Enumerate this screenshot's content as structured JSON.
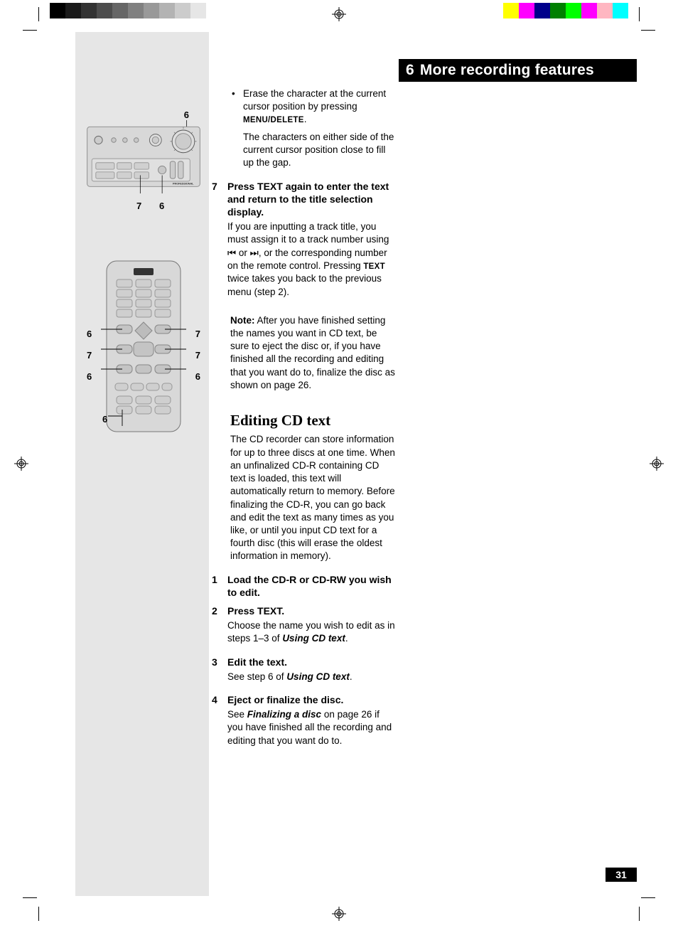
{
  "chapter": {
    "number": "6",
    "title": "More recording features"
  },
  "page_number": "31",
  "device_callouts": {
    "top": "6",
    "bottom_left": "7",
    "bottom_right": "6"
  },
  "remote_callouts": {
    "l1": "6",
    "r1": "7",
    "l2": "7",
    "r2": "7",
    "l3": "6",
    "r3": "6",
    "b1": "6"
  },
  "bullet1_a": "Erase the character at the current cursor position by pressing ",
  "bullet1_key": "MENU/DELETE",
  "bullet1_end": ".",
  "bullet1_sub": "The characters on either side of the current cursor position close to fill up the gap.",
  "step7": {
    "n": "7",
    "head": "Press TEXT again to enter the text and return to the title selection display."
  },
  "step7_body_a": "If you are inputting a track title, you must assign it to a track number using ",
  "step7_body_b": " or ",
  "step7_body_c": ", or the corresponding number on the remote control. Pressing ",
  "step7_body_key": "TEXT",
  "step7_body_d": " twice takes you back to the previous menu (step 2).",
  "note_label": "Note:",
  "note_body": " After you have finished setting the names you want in CD text, be sure to eject the disc or, if you have finished all the recording and editing that you want do to, finalize the disc as shown on page 26.",
  "heading_edit": "Editing CD text",
  "edit_intro": "The CD recorder can store information for up to three discs at one time. When an unfinalized CD-R containing CD text is loaded, this text will automatically return to memory. Before finalizing the CD-R, you can go back and edit the text as many times as you like, or until you input CD text for a fourth disc (this will erase the oldest information in memory).",
  "e1": {
    "n": "1",
    "head": "Load the CD-R or CD-RW you wish to edit."
  },
  "e2": {
    "n": "2",
    "head": "Press TEXT."
  },
  "e2_body_a": "Choose the name you wish to edit as in steps 1–3 of ",
  "e2_ref": "Using CD text",
  "e2_body_b": ".",
  "e3": {
    "n": "3",
    "head": "Edit the text."
  },
  "e3_body_a": "See step 6 of ",
  "e3_ref": "Using CD text",
  "e3_body_b": ".",
  "e4": {
    "n": "4",
    "head": "Eject or finalize the disc."
  },
  "e4_body_a": "See ",
  "e4_ref": "Finalizing a disc",
  "e4_body_b": " on page 26 if you have finished all the recording and editing that you want do to."
}
